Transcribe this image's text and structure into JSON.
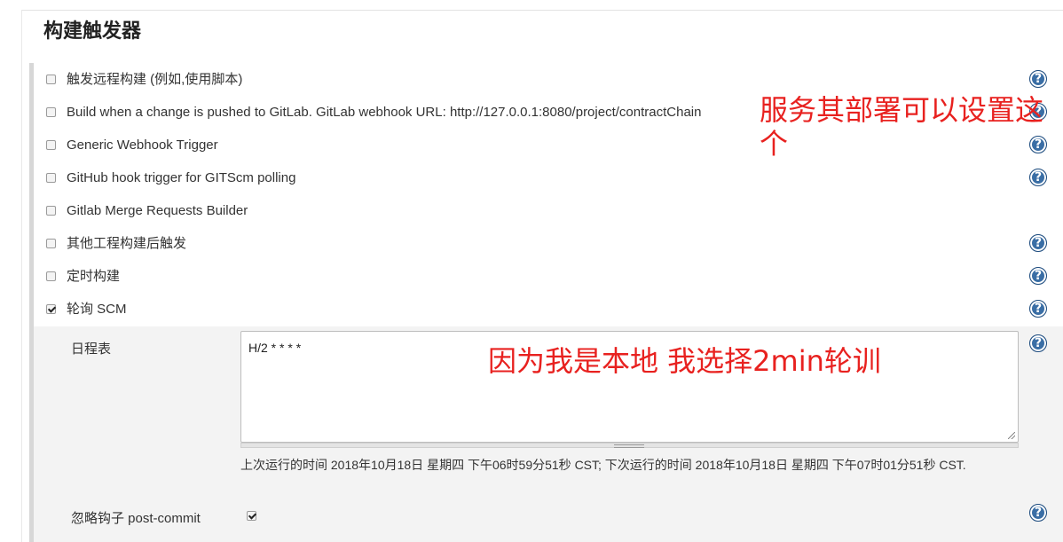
{
  "section": {
    "title": "构建触发器"
  },
  "triggers": [
    {
      "label": "触发远程构建 (例如,使用脚本)",
      "checked": false,
      "help": true
    },
    {
      "label": "Build when a change is pushed to GitLab. GitLab webhook URL: http://127.0.0.1:8080/project/contractChain",
      "checked": false,
      "help": true
    },
    {
      "label": "Generic Webhook Trigger",
      "checked": false,
      "help": true
    },
    {
      "label": "GitHub hook trigger for GITScm polling",
      "checked": false,
      "help": true
    },
    {
      "label": "Gitlab Merge Requests Builder",
      "checked": false,
      "help": false
    },
    {
      "label": "其他工程构建后触发",
      "checked": false,
      "help": true
    },
    {
      "label": "定时构建",
      "checked": false,
      "help": true
    },
    {
      "label": "轮询 SCM",
      "checked": true,
      "help": true
    }
  ],
  "poll_scm": {
    "schedule_label": "日程表",
    "schedule_value": "H/2 * * * *",
    "next_run_text": "上次运行的时间 2018年10月18日 星期四 下午06时59分51秒 CST; 下次运行的时间 2018年10月18日 星期四 下午07时01分51秒 CST.",
    "ignore_label": "忽略钩子 post-commit",
    "ignore_checked": true
  },
  "help_glyph": "?",
  "annotations": {
    "line1": "服务其部署可以设置这",
    "line2": "个",
    "line3": "因为我是本地  我选择2min轮训"
  },
  "colors": {
    "annotation": "#e8211f",
    "help_icon": "#3a6ea5"
  }
}
